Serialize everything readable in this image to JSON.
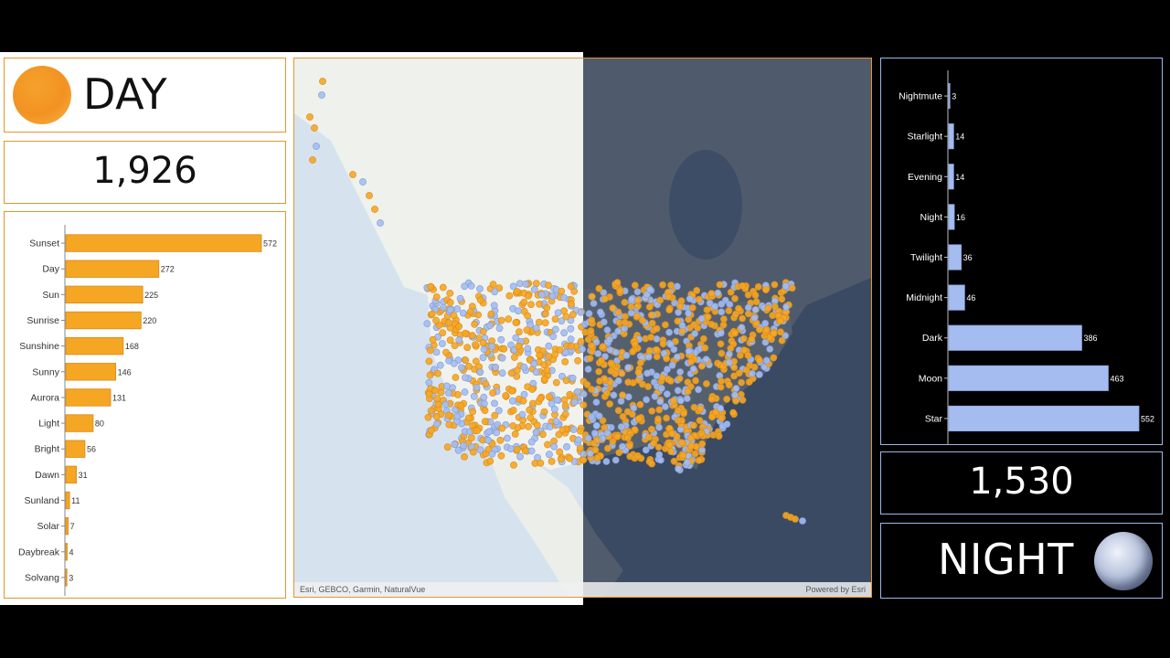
{
  "day": {
    "title": "DAY",
    "count": "1,926",
    "icon": "sun-icon",
    "color": "#f5a623"
  },
  "night": {
    "title": "NIGHT",
    "count": "1,530",
    "icon": "moon-icon",
    "color": "#a4bcf0"
  },
  "map": {
    "attribution_left": "Esri, GEBCO, Garmin, NaturalVue",
    "attribution_right": "Powered by Esri"
  },
  "chart_data": [
    {
      "type": "bar",
      "orientation": "horizontal",
      "categories": [
        "Sunset",
        "Day",
        "Sun",
        "Sunrise",
        "Sunshine",
        "Sunny",
        "Aurora",
        "Light",
        "Bright",
        "Dawn",
        "Sunland",
        "Solar",
        "Daybreak",
        "Solvang"
      ],
      "values": [
        572,
        272,
        225,
        220,
        168,
        146,
        131,
        80,
        56,
        31,
        11,
        7,
        4,
        3
      ],
      "color": "#f5a623"
    },
    {
      "type": "bar",
      "orientation": "horizontal",
      "categories": [
        "Nightmute",
        "Starlight",
        "Evening",
        "Night",
        "Twilight",
        "Midnight",
        "Dark",
        "Moon",
        "Star"
      ],
      "values": [
        3,
        14,
        14,
        16,
        36,
        46,
        386,
        463,
        552
      ],
      "color": "#a4bcf0"
    }
  ]
}
